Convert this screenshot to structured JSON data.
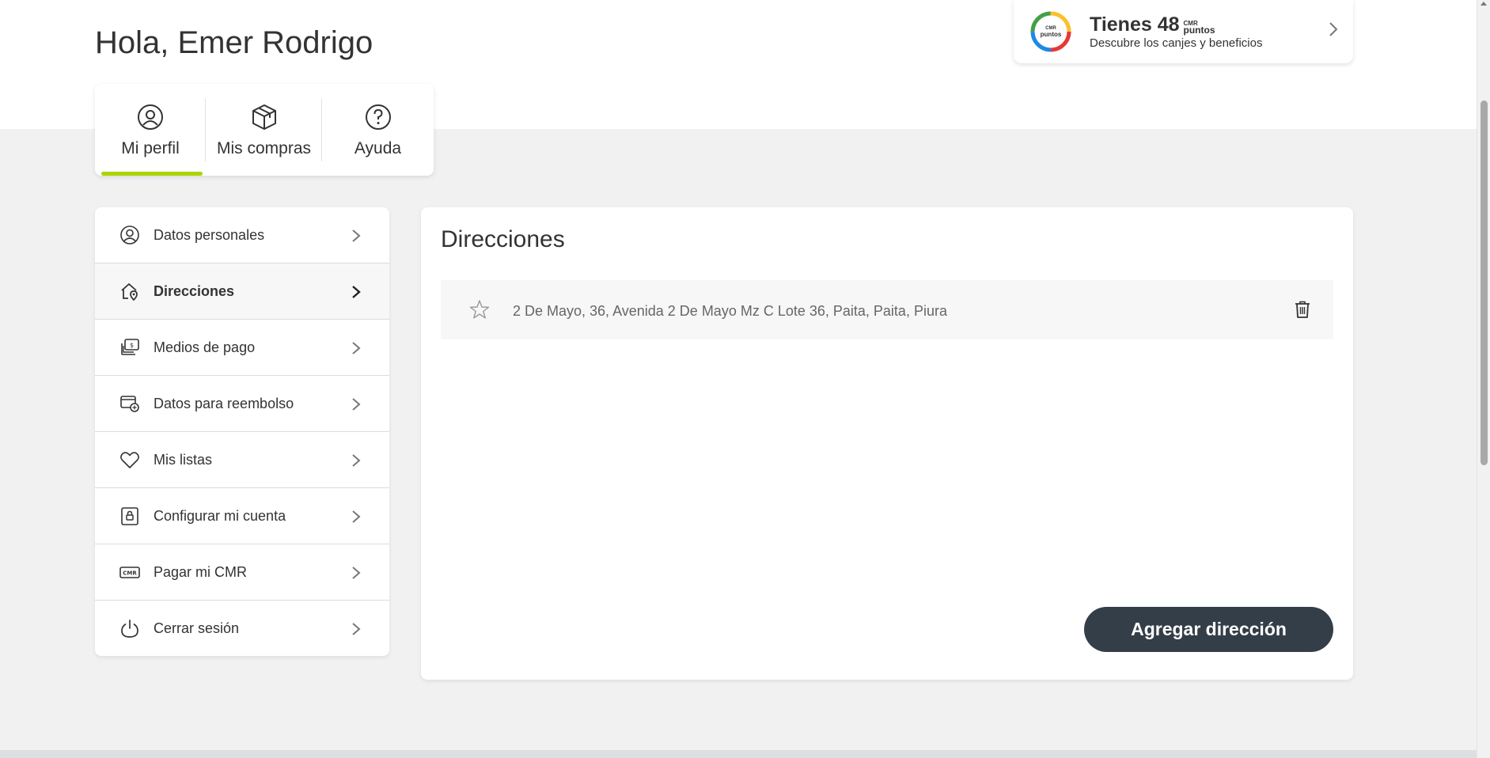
{
  "header": {
    "greeting": "Hola, Emer Rodrigo"
  },
  "points": {
    "logo_top": "CMR",
    "logo_bottom": "puntos",
    "headline": "Tienes 48",
    "brand_top": "CMR",
    "brand_bottom": "puntos",
    "subtitle": "Descubre los canjes y beneficios",
    "ring_colors": [
      "#e53935",
      "#1e88e5",
      "#43a047",
      "#fbc02d"
    ]
  },
  "tabs": [
    {
      "label": "Mi perfil",
      "icon": "user-circle-icon",
      "active": true
    },
    {
      "label": "Mis compras",
      "icon": "box-icon",
      "active": false
    },
    {
      "label": "Ayuda",
      "icon": "help-circle-icon",
      "active": false
    }
  ],
  "menu": [
    {
      "label": "Datos personales",
      "icon": "user-circle-icon",
      "active": false
    },
    {
      "label": "Direcciones",
      "icon": "home-location-icon",
      "active": true
    },
    {
      "label": "Medios de pago",
      "icon": "payment-cards-icon",
      "active": false
    },
    {
      "label": "Datos para reembolso",
      "icon": "refund-card-icon",
      "active": false
    },
    {
      "label": "Mis listas",
      "icon": "heart-icon",
      "active": false
    },
    {
      "label": "Configurar mi cuenta",
      "icon": "lock-icon",
      "active": false
    },
    {
      "label": "Pagar mi CMR",
      "icon": "cmr-card-icon",
      "active": false
    },
    {
      "label": "Cerrar sesión",
      "icon": "power-icon",
      "active": false
    }
  ],
  "content": {
    "title": "Direcciones",
    "addresses": [
      {
        "text": "2 De Mayo, 36, Avenida 2 De Mayo Mz C Lote 36, Paita, Paita, Piura"
      }
    ],
    "add_button": "Agregar dirección"
  },
  "colors": {
    "accent": "#aad500",
    "button_bg": "#343e48"
  }
}
